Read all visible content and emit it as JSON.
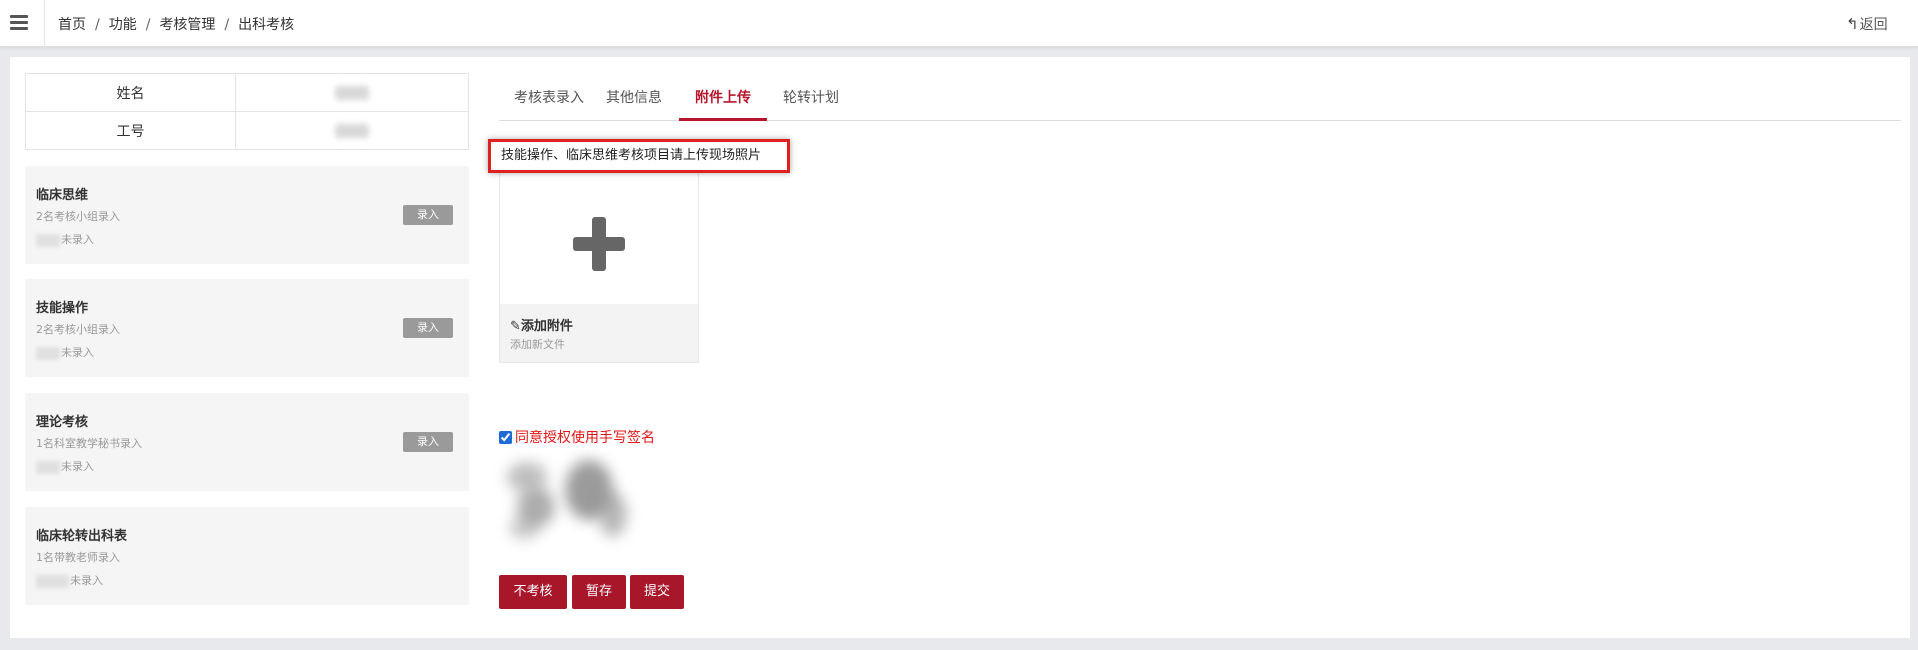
{
  "topbar": {
    "breadcrumb": [
      "首页",
      "功能",
      "考核管理",
      "出科考核"
    ],
    "separator": "/",
    "back_label": "返回"
  },
  "info_table": {
    "rows": [
      {
        "label": "姓名"
      },
      {
        "label": "工号"
      }
    ]
  },
  "tasks": [
    {
      "title": "临床思维",
      "subtitle": "2名考核小组录入",
      "status": "未录入",
      "button": "录入"
    },
    {
      "title": "技能操作",
      "subtitle": "2名考核小组录入",
      "status": "未录入",
      "button": "录入"
    },
    {
      "title": "理论考核",
      "subtitle": "1名科室教学秘书录入",
      "status": "未录入",
      "button": "录入"
    },
    {
      "title": "临床轮转出科表",
      "subtitle": "1名带教老师录入",
      "status": "未录入"
    }
  ],
  "tabs": [
    {
      "label": "考核表录入",
      "active": false
    },
    {
      "label": "其他信息",
      "active": false
    },
    {
      "label": "附件上传",
      "active": true
    },
    {
      "label": "轮转计划",
      "active": false
    }
  ],
  "upload": {
    "notice": "技能操作、临床思维考核项目请上传现场照片",
    "add_title": "添加附件",
    "add_subtitle": "添加新文件"
  },
  "signature": {
    "agree_label": "同意授权使用手写签名",
    "agree_checked": true
  },
  "actions": {
    "skip": "不考核",
    "save": "暂存",
    "submit": "提交"
  },
  "colors": {
    "accent": "#b5162c",
    "button_bg": "#a8162a",
    "notice_border": "#dd2020",
    "agree_text": "#e01818"
  }
}
